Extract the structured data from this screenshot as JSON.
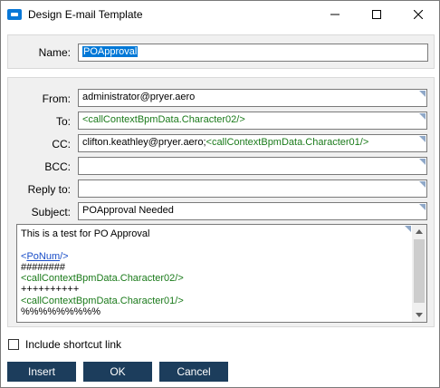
{
  "window": {
    "title": "Design E-mail Template",
    "minimize_icon": "minimize-icon",
    "maximize_icon": "maximize-icon",
    "close_icon": "close-icon"
  },
  "form": {
    "name_label": "Name:",
    "name_value": "POApproval",
    "from_label": "From:",
    "from_value": "administrator@pryer.aero",
    "to_label": "To:",
    "to_value": "<callContextBpmData.Character02/>",
    "cc_label": "CC:",
    "cc_value_plain": "clifton.keathley@pryer.aero;",
    "cc_value_tag": "<callContextBpmData.Character01/>",
    "bcc_label": "BCC:",
    "bcc_value": "",
    "replyto_label": "Reply to:",
    "replyto_value": "",
    "subject_label": "Subject:",
    "subject_value": "POApproval Needed"
  },
  "body": {
    "line1": "This is a test for PO Approval",
    "line2": "",
    "line3_open": "<",
    "line3_link": "PoNum",
    "line3_close": "/>",
    "line4": "########",
    "line5": "<callContextBpmData.Character02/>",
    "line6": "++++++++++",
    "line7": "<callContextBpmData.Character01/>",
    "line8": "%%%%%%%%%"
  },
  "options": {
    "shortcut_label": "Include shortcut link",
    "shortcut_checked": false
  },
  "buttons": {
    "insert": "Insert",
    "ok": "OK",
    "cancel": "Cancel"
  },
  "colors": {
    "button_bg": "#1c3d5c",
    "tag_green": "#1a7a1a",
    "link_blue": "#1a4ec8",
    "selection_blue": "#0078d7"
  }
}
